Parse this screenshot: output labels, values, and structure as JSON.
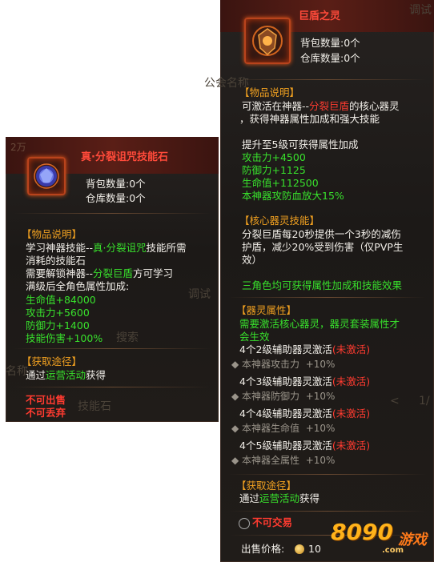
{
  "background": {
    "texts": [
      "调试",
      "公会名称",
      "2万",
      "调试",
      "名称",
      "搜索",
      "名称",
      "技能石",
      "1/"
    ]
  },
  "left": {
    "title": "真·分裂诅咒技能石",
    "bag_count": "背包数量:0个",
    "store_count": "仓库数量:0个",
    "section1": "【物品说明】",
    "desc_line1_a": "学习神器技能--",
    "desc_line1_b": "真·分裂诅咒",
    "desc_line1_c": "技能所需",
    "desc_line2": "消耗的技能石",
    "desc_line3_a": "需要解锁神器--",
    "desc_line3_b": "分裂巨盾",
    "desc_line3_c": "方可学习",
    "desc_line4": "满级后全角色属性加成:",
    "stats": [
      "生命值+84000",
      "攻击力+5600",
      "防御力+1400",
      "技能伤害+100%"
    ],
    "section2": "【获取途径】",
    "obtain_a": "通过",
    "obtain_b": "运营活动",
    "obtain_c": "获得",
    "flags": [
      "不可出售",
      "不可丢弃"
    ]
  },
  "right": {
    "title": "巨盾之灵",
    "bag_count": "背包数量:0个",
    "store_count": "仓库数量:0个",
    "section1": "【物品说明】",
    "desc1_a": "可激活在神器--",
    "desc1_b": "分裂巨盾",
    "desc1_c": "的核心器灵",
    "desc2": "，获得神器属性加成和强大技能",
    "upgrade": "提升至5级可获得属性加成",
    "stats": [
      "攻击力+4500",
      "防御力+1125",
      "生命值+112500",
      "本神器攻防血放大15%"
    ],
    "section2": "【核心器灵技能】",
    "skill1": "分裂巨盾每20秒提供一个3秒的减伤",
    "skill2": "护盾，减少20%受到伤害（仅PVP生",
    "skill3": "效）",
    "bonus": "三角色均可获得属性加成和技能效果",
    "section3": "【器灵属性】",
    "need1": "需要激活核心器灵，器灵套装属性才",
    "need2": "会生效",
    "sets": [
      {
        "label": "4个2级辅助器灵激活",
        "state": "(未激活)",
        "attr": "本神器攻击力",
        "val": "+10%"
      },
      {
        "label": "4个3级辅助器灵激活",
        "state": "(未激活)",
        "attr": "本神器防御力",
        "val": "+10%"
      },
      {
        "label": "4个4级辅助器灵激活",
        "state": "(未激活)",
        "attr": "本神器生命值",
        "val": "+10%"
      },
      {
        "label": "4个5级辅助器灵激活",
        "state": "(未激活)",
        "attr": "本神器全属性",
        "val": "+10%"
      }
    ],
    "section4": "【获取途径】",
    "obtain_a": "通过",
    "obtain_b": "运营活动",
    "obtain_c": "获得",
    "no_trade": "不可交易",
    "price_label": "出售价格:",
    "price": "10"
  },
  "watermark": {
    "brand": "8090",
    "game": "游戏",
    "domain": ".com"
  },
  "colors": {
    "red": "#ff3b30",
    "green": "#38e02c",
    "orange": "#f0a020",
    "title_red": "#ff4a3a"
  }
}
